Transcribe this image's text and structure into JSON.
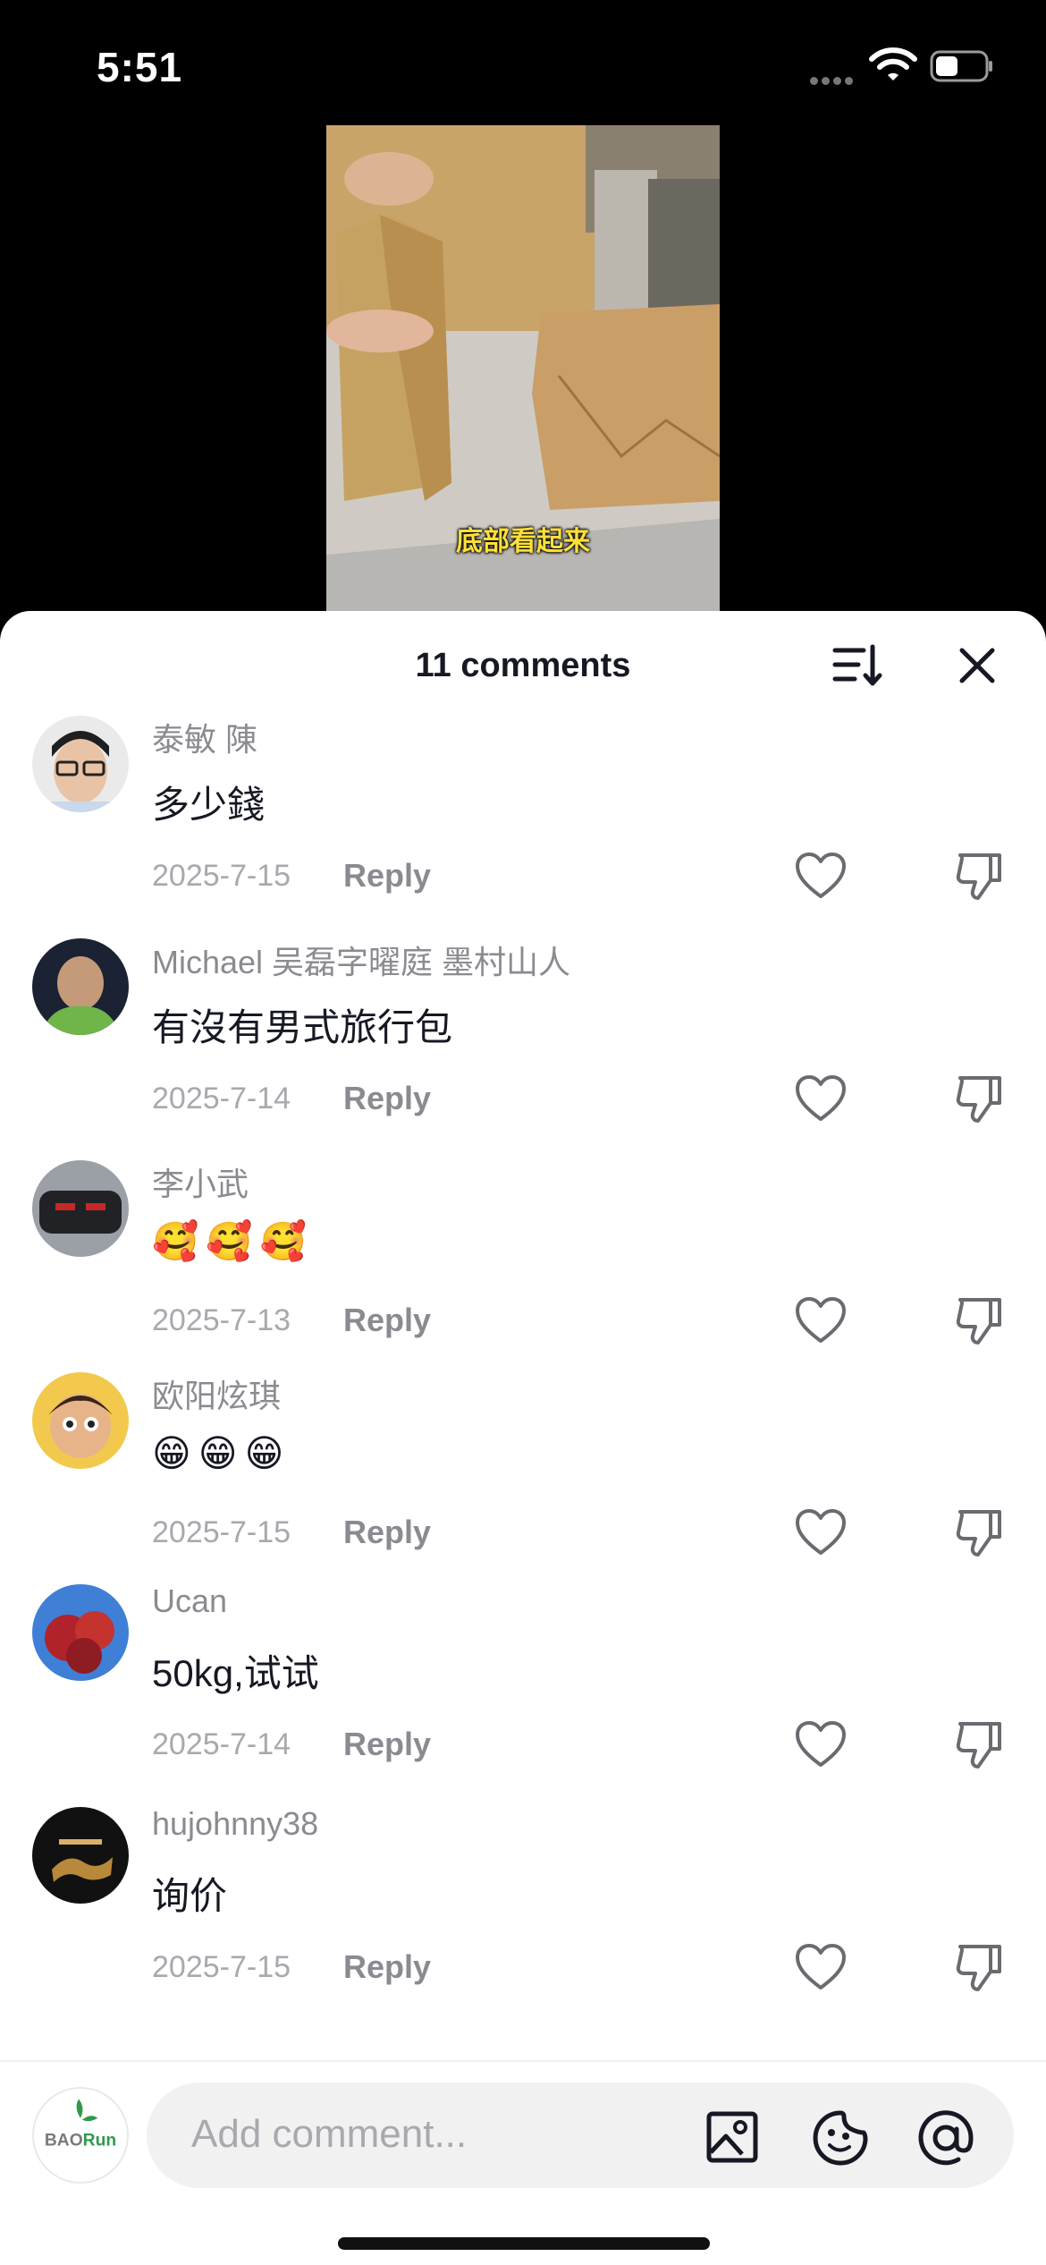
{
  "status_bar": {
    "time": "5:51",
    "icons": [
      "cellular-signal-icon",
      "wifi-icon",
      "battery-icon"
    ]
  },
  "video": {
    "caption": "底部看起来"
  },
  "sheet": {
    "title": "11 comments",
    "icons": {
      "sort": "sort-icon",
      "close": "close-icon"
    }
  },
  "comments": [
    {
      "username": "泰敏 陳",
      "text": "多少錢",
      "date": "2025-7-15",
      "reply_label": "Reply"
    },
    {
      "username": "Michael 吴磊字曜庭  墨村山人",
      "text": "有沒有男式旅行包",
      "date": "2025-7-14",
      "reply_label": "Reply"
    },
    {
      "username": "李小武",
      "text": "🥰🥰🥰",
      "date": "2025-7-13",
      "reply_label": "Reply"
    },
    {
      "username": "欧阳炫琪",
      "text": "😁😁😁",
      "date": "2025-7-15",
      "reply_label": "Reply"
    },
    {
      "username": "Ucan",
      "text": "50kg,试试",
      "date": "2025-7-14",
      "reply_label": "Reply"
    },
    {
      "username": "hujohnny38",
      "text": "询价",
      "date": "2025-7-15",
      "reply_label": "Reply"
    }
  ],
  "composer": {
    "avatar_text": "BAORun",
    "placeholder": "Add comment...",
    "icons": [
      "image-icon",
      "sticker-icon",
      "mention-icon"
    ]
  },
  "colors": {
    "text_primary": "#161823",
    "text_secondary": "#8a8b91",
    "background": "#ffffff"
  }
}
